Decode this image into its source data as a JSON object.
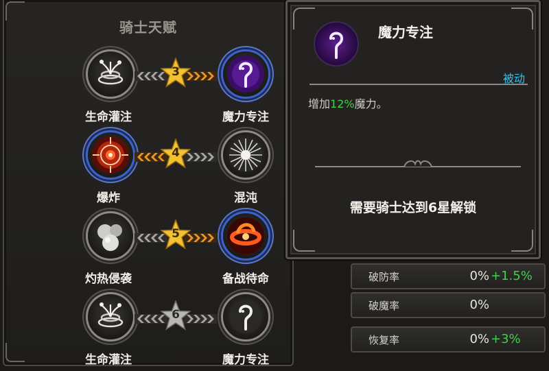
{
  "talent_panel": {
    "title": "骑士天赋",
    "rows": [
      {
        "left_label": "生命灌注",
        "right_label": "魔力专注",
        "star_level": "3",
        "left_icon": "vine-swirl-icon",
        "right_icon": "magic-hook-icon"
      },
      {
        "left_label": "爆炸",
        "right_label": "混沌",
        "star_level": "4",
        "left_icon": "explosion-target-icon",
        "right_icon": "chaos-burst-icon"
      },
      {
        "left_label": "灼热侵袭",
        "right_label": "备战待命",
        "star_level": "5",
        "left_icon": "fireballs-icon",
        "right_icon": "flame-ring-icon"
      },
      {
        "left_label": "生命灌注",
        "right_label": "魔力专注",
        "star_level": "6",
        "left_icon": "vine-swirl-icon",
        "right_icon": "magic-hook-icon"
      }
    ]
  },
  "tooltip": {
    "title": "魔力专注",
    "type": "被动",
    "desc_prefix": "增加",
    "desc_value": "12%",
    "desc_suffix": "魔力。",
    "unlock_text": "需要骑士达到6星解锁",
    "icon": "magic-hook-icon"
  },
  "stats": [
    {
      "label": "破防率",
      "value": "0%",
      "bonus": "+1.5%"
    },
    {
      "label": "破魔率",
      "value": "0%",
      "bonus": ""
    },
    {
      "label": "恢复率",
      "value": "0%",
      "bonus": "+3%"
    }
  ],
  "colors": {
    "accent_blue": "#35c0f0",
    "bonus_green": "#3fd24a",
    "star_gold": "#f2c230",
    "star_grey": "#b9b7b2",
    "connector_orange": "#e8962a"
  }
}
